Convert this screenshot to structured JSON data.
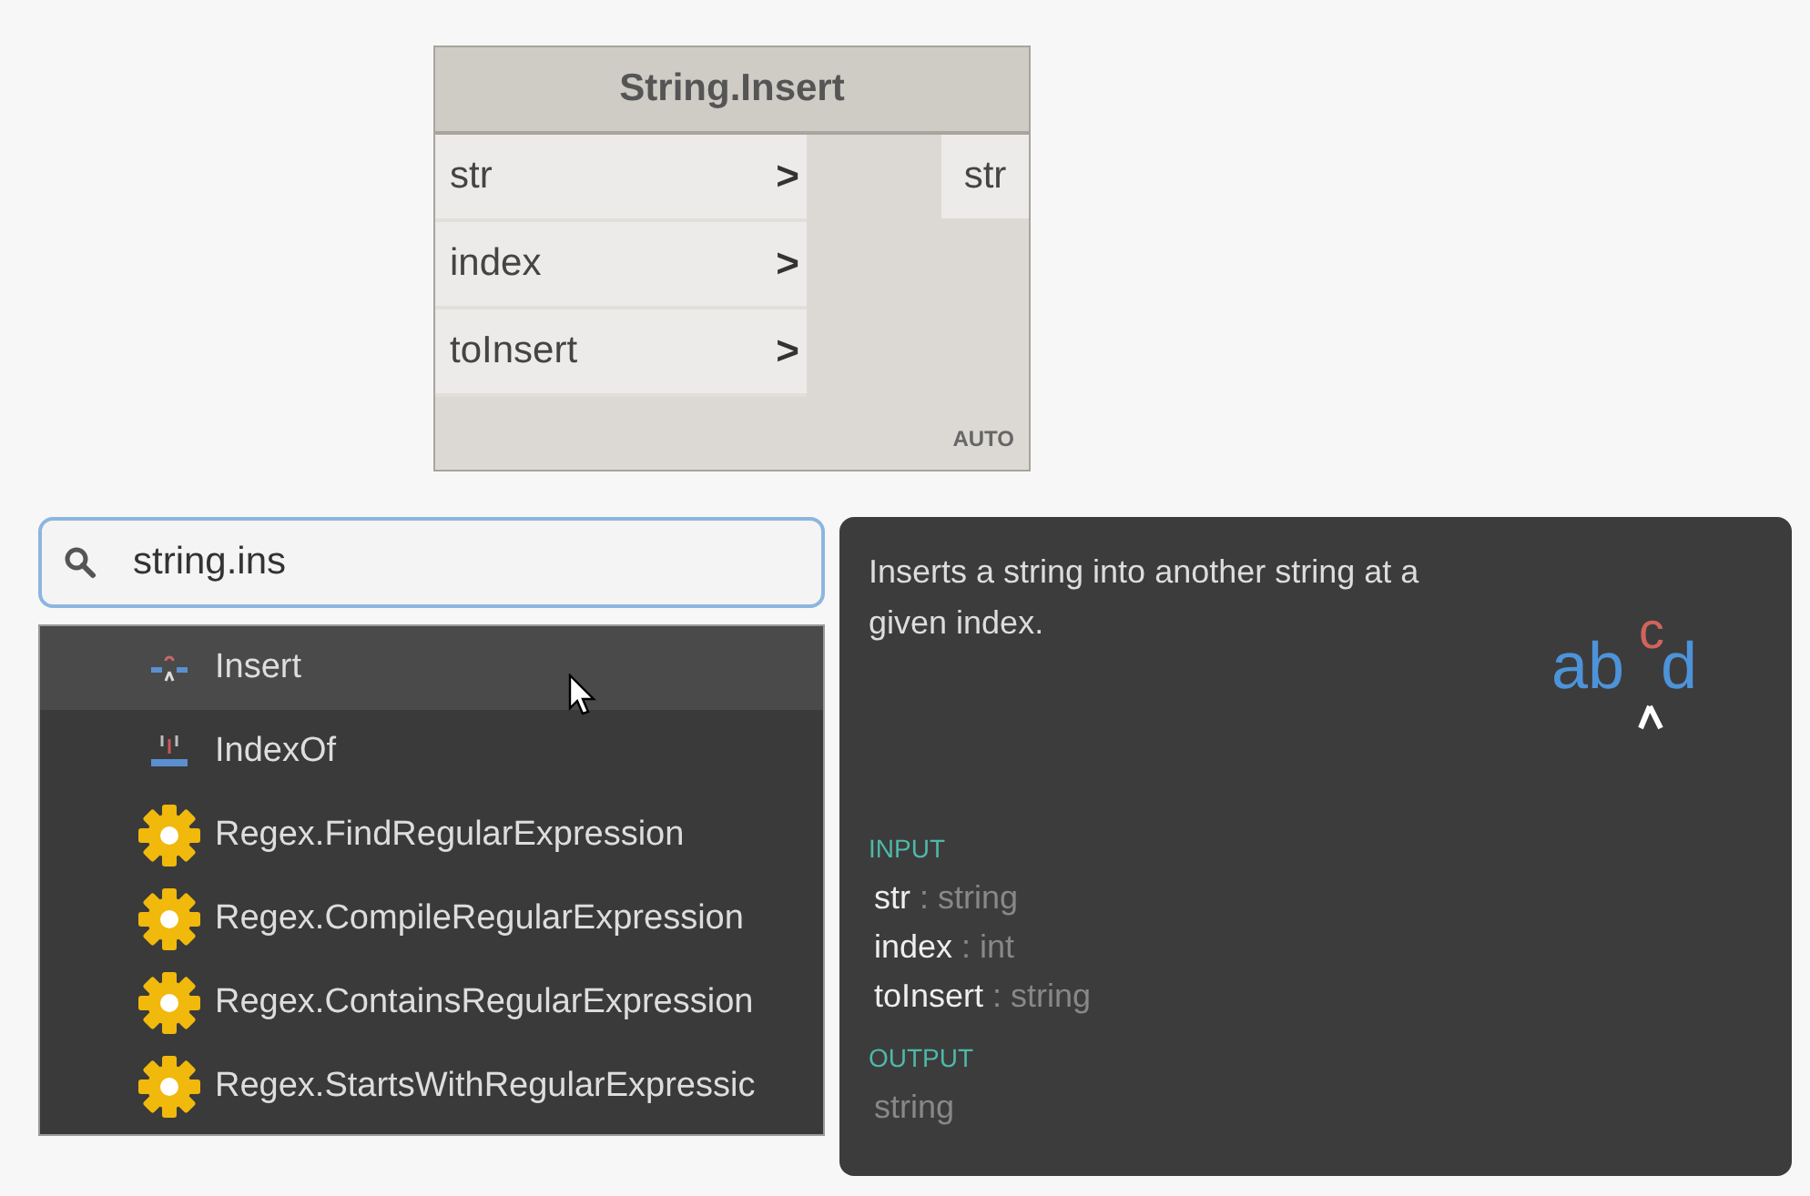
{
  "node": {
    "title": "String.Insert",
    "inputs": [
      {
        "name": "str",
        "arrow": ">"
      },
      {
        "name": "index",
        "arrow": ">"
      },
      {
        "name": "toInsert",
        "arrow": ">"
      }
    ],
    "outputs": [
      "str"
    ],
    "lacing": "AUTO"
  },
  "search": {
    "value": "string.ins"
  },
  "results": [
    {
      "label": "Insert",
      "kind": "insert",
      "selected": true
    },
    {
      "label": "IndexOf",
      "kind": "indexof",
      "selected": false
    },
    {
      "label": "Regex.FindRegularExpression",
      "kind": "gear",
      "selected": false
    },
    {
      "label": "Regex.CompileRegularExpression",
      "kind": "gear",
      "selected": false
    },
    {
      "label": "Regex.ContainsRegularExpression",
      "kind": "gear",
      "selected": false
    },
    {
      "label": "Regex.StartsWithRegularExpressic",
      "kind": "gear",
      "selected": false
    }
  ],
  "tooltip": {
    "description": "Inserts a string into another string at a given index.",
    "preview": {
      "left": "ab",
      "insert": "c",
      "right": "d"
    },
    "input_heading": "INPUT",
    "inputs": [
      {
        "name": "str",
        "type": ": string"
      },
      {
        "name": "index",
        "type": ": int"
      },
      {
        "name": "toInsert",
        "type": ": string"
      }
    ],
    "output_heading": "OUTPUT",
    "output": "string"
  }
}
